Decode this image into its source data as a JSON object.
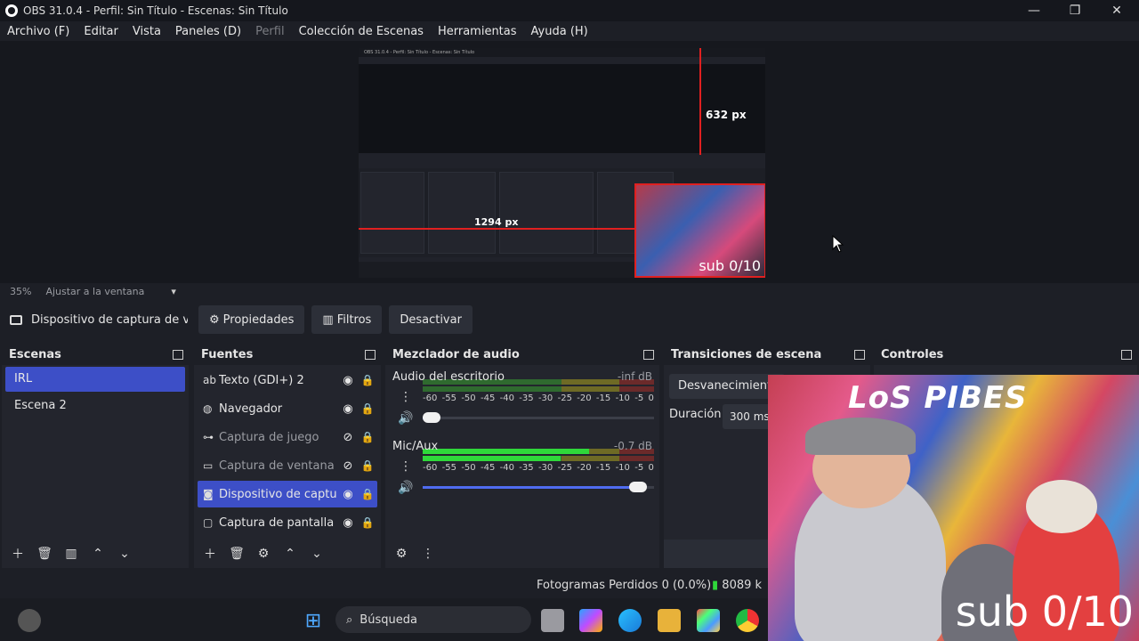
{
  "window": {
    "title": "OBS 31.0.4 - Perfil: Sin Título - Escenas: Sin Título",
    "minimize": "—",
    "maximize": "❐",
    "close": "✕"
  },
  "menu": [
    {
      "label": "Archivo (F)",
      "enabled": true
    },
    {
      "label": "Editar",
      "enabled": true
    },
    {
      "label": "Vista",
      "enabled": true
    },
    {
      "label": "Paneles (D)",
      "enabled": true
    },
    {
      "label": "Perfil",
      "enabled": false
    },
    {
      "label": "Colección de Escenas",
      "enabled": true
    },
    {
      "label": "Herramientas",
      "enabled": true
    },
    {
      "label": "Ayuda (H)",
      "enabled": true
    }
  ],
  "preview": {
    "measure_vertical": "632 px",
    "measure_horizontal": "1294 px",
    "overlay_text": "sub 0/10",
    "mini_title": "OBS 31.0.4 - Perfil: Sin Título - Escenas: Sin Título"
  },
  "zoom": {
    "level": "35%",
    "mode": "Ajustar a la ventana",
    "chevron": "▾"
  },
  "source_toolbar": {
    "selected_source": "Dispositivo de captura de v",
    "properties": "Propiedades",
    "filters": "Filtros",
    "deactivate": "Desactivar"
  },
  "scenes": {
    "title": "Escenas",
    "items": [
      {
        "label": "IRL",
        "active": true
      },
      {
        "label": "Escena 2",
        "active": false
      }
    ]
  },
  "sources": {
    "title": "Fuentes",
    "items": [
      {
        "label": "Texto (GDI+) 2",
        "icon": "text-icon",
        "glyph": "ab",
        "visible": true,
        "active": false
      },
      {
        "label": "Navegador",
        "icon": "globe-icon",
        "glyph": "◍",
        "visible": true,
        "active": false
      },
      {
        "label": "Captura de juego",
        "icon": "gamepad-icon",
        "glyph": "⊶",
        "visible": false,
        "active": false
      },
      {
        "label": "Captura de ventana",
        "icon": "window-icon",
        "glyph": "▭",
        "visible": false,
        "active": false
      },
      {
        "label": "Dispositivo de captu",
        "icon": "camera-icon",
        "glyph": "◙",
        "visible": true,
        "active": true
      },
      {
        "label": "Captura de pantalla",
        "icon": "monitor-icon",
        "glyph": "▢",
        "visible": true,
        "active": false
      }
    ]
  },
  "mixer": {
    "title": "Mezclador de audio",
    "scale": [
      "-60",
      "-55",
      "-50",
      "-45",
      "-40",
      "-35",
      "-30",
      "-25",
      "-20",
      "-15",
      "-10",
      "-5",
      "0"
    ],
    "channels": [
      {
        "name": "Audio del escritorio",
        "db": "-inf dB",
        "level": 0.0,
        "volume": 0.04
      },
      {
        "name": "Mic/Aux",
        "db": "-0.7 dB",
        "level": 0.72,
        "volume": 0.93
      }
    ]
  },
  "transitions": {
    "title": "Transiciones de escena",
    "selected": "Desvanecimiento",
    "duration_label": "Duración",
    "duration_value": "300 ms"
  },
  "controls": {
    "title": "Controles"
  },
  "webcam": {
    "graffiti": "LoS PIBES",
    "overlay_text": "sub 0/10"
  },
  "status": {
    "dropped_frames": "Fotogramas Perdidos 0 (0.0%)",
    "bitrate": "8089 k"
  },
  "taskbar": {
    "search_placeholder": "Búsqueda"
  }
}
